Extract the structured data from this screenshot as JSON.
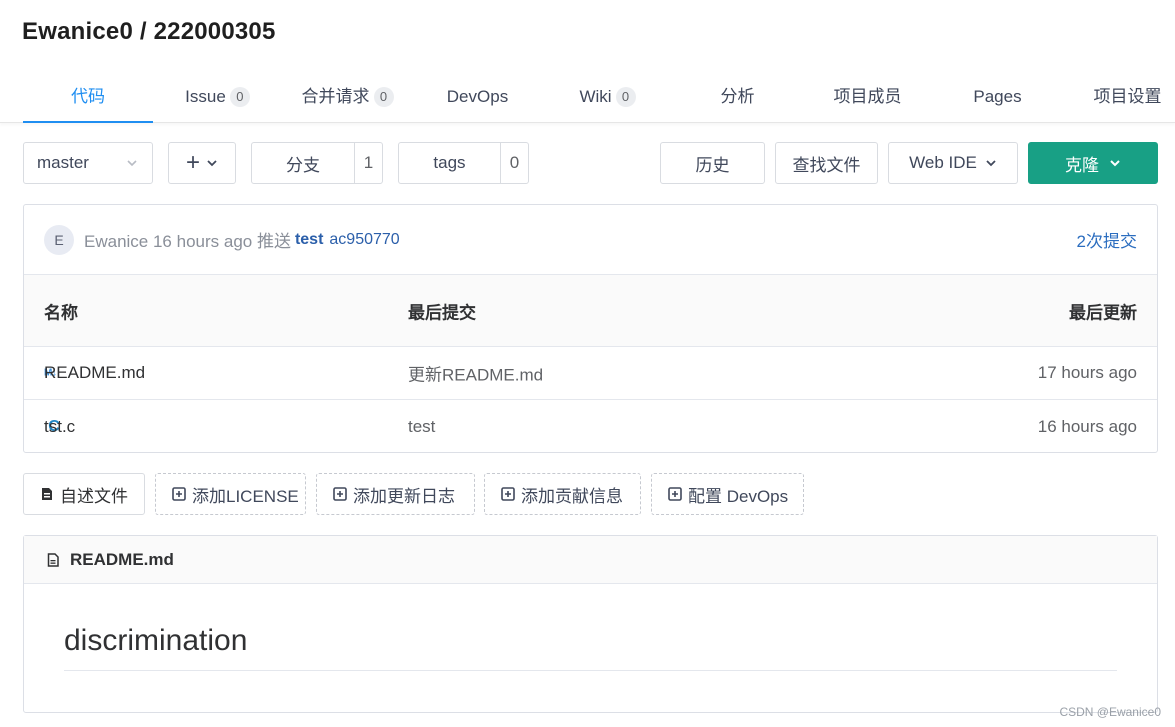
{
  "repo": {
    "title": "Ewanice0 / 222000305"
  },
  "tabs": [
    {
      "label": "代码",
      "count": null
    },
    {
      "label": "Issue",
      "count": "0"
    },
    {
      "label": "合并请求",
      "count": "0"
    },
    {
      "label": "DevOps",
      "count": null
    },
    {
      "label": "Wiki",
      "count": "0"
    },
    {
      "label": "分析",
      "count": null
    },
    {
      "label": "项目成员",
      "count": null
    },
    {
      "label": "Pages",
      "count": null
    },
    {
      "label": "项目设置",
      "count": null
    }
  ],
  "toolbar": {
    "branch": "master",
    "plus": "+",
    "branches_label": "分支",
    "branches_count": "1",
    "tags_label": "tags",
    "tags_count": "0",
    "history": "历史",
    "find_file": "查找文件",
    "web_ide": "Web IDE",
    "clone": "克隆"
  },
  "commit": {
    "avatar": "E",
    "author_time": "Ewanice 16 hours ago 推送",
    "message": "test",
    "hash": "ac950770",
    "count": "2次提交"
  },
  "table": {
    "headers": {
      "name": "名称",
      "last_commit": "最后提交",
      "last_update": "最后更新"
    },
    "rows": [
      {
        "icon": "M↓",
        "name": "README.md",
        "commit": "更新README.md",
        "time": "17 hours ago"
      },
      {
        "icon": "C",
        "name": "tst.c",
        "commit": "test",
        "time": "16 hours ago"
      }
    ]
  },
  "actions": {
    "readme": "自述文件",
    "license": "添加LICENSE",
    "changelog": "添加更新日志",
    "contrib": "添加贡献信息",
    "devops": "配置 DevOps"
  },
  "readme": {
    "filename": "README.md",
    "heading": "discrimination"
  },
  "watermark": "CSDN @Ewanice0",
  "colors": {
    "accent": "#1f8ef1",
    "clone": "#18a085",
    "link": "#2b5faa"
  }
}
